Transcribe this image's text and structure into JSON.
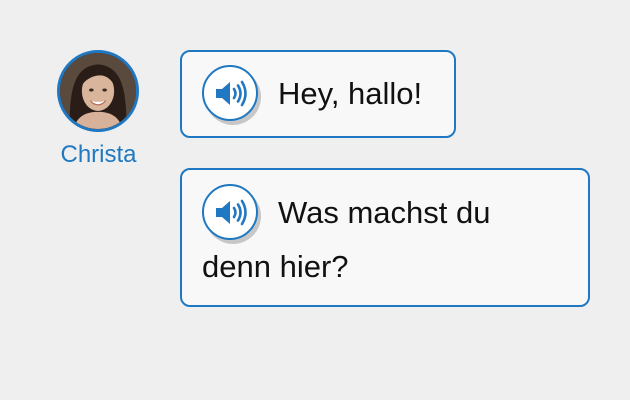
{
  "speaker": {
    "name": "Christa",
    "avatar": "christa-portrait"
  },
  "messages": [
    {
      "icon": "speaker-volume-icon",
      "text": "Hey, hallo!"
    },
    {
      "icon": "speaker-volume-icon",
      "text": "Was machst du denn hier?"
    }
  ],
  "colors": {
    "accent": "#1f78c1",
    "background": "#efefef",
    "bubble": "#f8f8f8"
  }
}
